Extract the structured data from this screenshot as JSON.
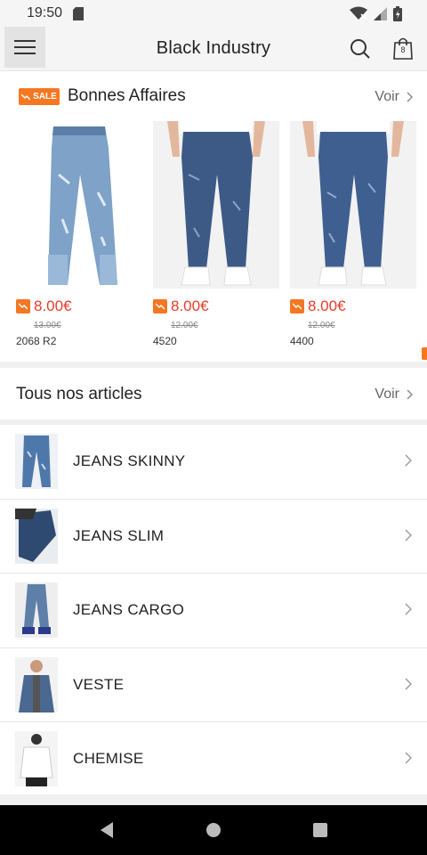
{
  "status_bar": {
    "time": "19:50",
    "icons": [
      "sd-card-icon",
      "wifi-icon",
      "signal-icon",
      "battery-icon"
    ]
  },
  "header": {
    "title": "Black Industry",
    "cart_count": "8"
  },
  "deals": {
    "badge": "SALE",
    "title": "Bonnes Affaires",
    "voir_label": "Voir",
    "products": [
      {
        "price": "8.00€",
        "old_price": "13.00€",
        "name": "2068 R2"
      },
      {
        "price": "8.00€",
        "old_price": "12.00€",
        "name": "4520"
      },
      {
        "price": "8.00€",
        "old_price": "12.00€",
        "name": "4400"
      }
    ]
  },
  "all_articles": {
    "title": "Tous nos articles",
    "voir_label": "Voir"
  },
  "categories": [
    {
      "label": "JEANS SKINNY"
    },
    {
      "label": "JEANS SLIM"
    },
    {
      "label": "JEANS CARGO"
    },
    {
      "label": "VESTE"
    },
    {
      "label": "CHEMISE"
    }
  ],
  "colors": {
    "accent": "#f57722",
    "price": "#e53c2a"
  }
}
